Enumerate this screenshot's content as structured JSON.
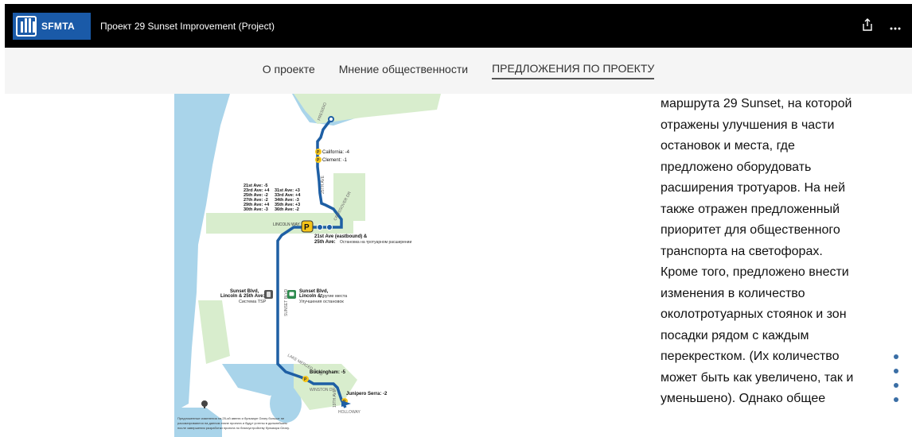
{
  "header": {
    "logo_text": "SFMTA",
    "title": "Проект 29 Sunset Improvement (Project)",
    "share_icon": "share-icon",
    "more_icon": "more-icon"
  },
  "nav": {
    "tabs": [
      {
        "label": "О проекте"
      },
      {
        "label": "Мнение общественности"
      },
      {
        "label": "ПРЕДЛОЖЕНИЯ ПО ПРОЕКТУ",
        "active": true
      }
    ]
  },
  "map": {
    "street_labels": {
      "presidio": "PRESIDIO",
      "ave25": "25TH AVE",
      "lincoln_way": "LINCOLN WAY",
      "crossover": "CROSSOVER DR",
      "sunset_blvd": "SUNSET BLVD",
      "lake_merced": "LAKE MERCED BLVD",
      "winston": "WINSTON DR",
      "ave19": "19TH AVE",
      "holloway": "HOLLOWAY"
    },
    "california": "California: -4",
    "clement": "Clement: -1",
    "left_list": [
      "21st Ave: -5",
      "23rd Ave: +4",
      "25th Ave: -2",
      "27th Ave: -2",
      "29th Ave: +4",
      "30th Ave: -3"
    ],
    "right_list": [
      "31st Ave: +3",
      "33rd Ave: +4",
      "34th Ave: -3",
      "35th Ave: +3",
      "36th Ave: -2"
    ],
    "stop_title_1": "21st Ave (eastbound) &",
    "stop_title_2": "25th Ave:",
    "stop_note": "Остановка на тротуарном расширении",
    "tsp_title_1": "Sunset Blvd,",
    "tsp_title_2": "Lincoln & 25th Ave:",
    "tsp_note": "Система TSP",
    "bus_title_1": "Sunset Blvd,",
    "bus_title_2": "Lincoln &",
    "bus_note_1": "Другие места",
    "bus_note_2": "Улучшения остановок",
    "buckingham": "Buckingham: -5",
    "junipero": "Junipero Serra: -2",
    "footnote": [
      "Предложенные изменения на 25-ой авеню и бульваре Geary больше не",
      "рассматриваются на данном этапе проекта и будут учтены в дальнейшем",
      "после завершения разработки проекта по благоустройству бульвара Geary."
    ],
    "colors": {
      "water": "#a9d4ea",
      "park": "#d8edcd",
      "route": "#1e5fa4",
      "parking": "#f5c518"
    }
  },
  "body": {
    "lines": [
      "маршрута 29 Sunset, на которой",
      "отражены улучшения в части",
      "остановок и места, где",
      "предложено оборудовать",
      "расширения тротуаров. На ней",
      "также отражен предложенный",
      "приоритет для общественного",
      "транспорта на светофорах.",
      "Кроме того, предложено внести",
      "изменения в количество",
      "околотротуарных стоянок и зон",
      "посадки рядом с каждым",
      "перекрестком. (Их количество",
      "может быть как увеличено, так и",
      "уменьшено). Однако общее"
    ]
  },
  "pager": {
    "count": 4
  }
}
